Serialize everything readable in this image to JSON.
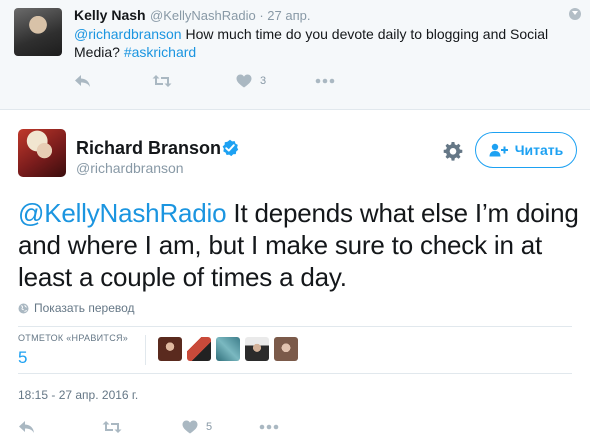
{
  "reply_tweet": {
    "author_name": "Kelly Nash",
    "author_handle": "@KellyNashRadio",
    "separator": "·",
    "date": "27 апр.",
    "mention": "@richardbranson",
    "text": " How much time do you devote daily to blogging and Social Media? ",
    "hashtag": "#askrichard",
    "like_count": "3",
    "icons": [
      "reply-icon",
      "retweet-icon",
      "like-icon",
      "more-icon",
      "caret-down-icon"
    ]
  },
  "main_tweet": {
    "author_name": "Richard Branson",
    "author_handle": "@richardbranson",
    "follow_label": "Читать",
    "mention": "@KellyNashRadio",
    "text": " It depends what else I’m doing and where I am, but I make sure to check in at least a couple of times a day.",
    "translate_label": "Показать перевод",
    "likes_label": "ОТМЕТОК «НРАВИТСЯ»",
    "likes_count": "5",
    "timestamp": "18:15 - 27 апр. 2016 г.",
    "action_like_count": "5",
    "icons": [
      "verified-badge-icon",
      "gear-icon",
      "follow-user-icon",
      "globe-icon",
      "reply-icon",
      "retweet-icon",
      "like-icon",
      "more-icon"
    ]
  },
  "likers": [
    {
      "name": "liker-avatar-1",
      "color": "#5a2a1e"
    },
    {
      "name": "liker-avatar-2",
      "color": "#c94a3a"
    },
    {
      "name": "liker-avatar-3",
      "color": "#3d7d8a"
    },
    {
      "name": "liker-avatar-4",
      "color": "#2b2b2b"
    },
    {
      "name": "liker-avatar-5",
      "color": "#7b5a4a"
    }
  ],
  "colors": {
    "accent": "#1da1f2",
    "link": "#1b95e0",
    "muted": "#8899a6",
    "icon": "#aab8c2",
    "reply_background": "#f5f8fa",
    "border": "#e1e8ed"
  }
}
